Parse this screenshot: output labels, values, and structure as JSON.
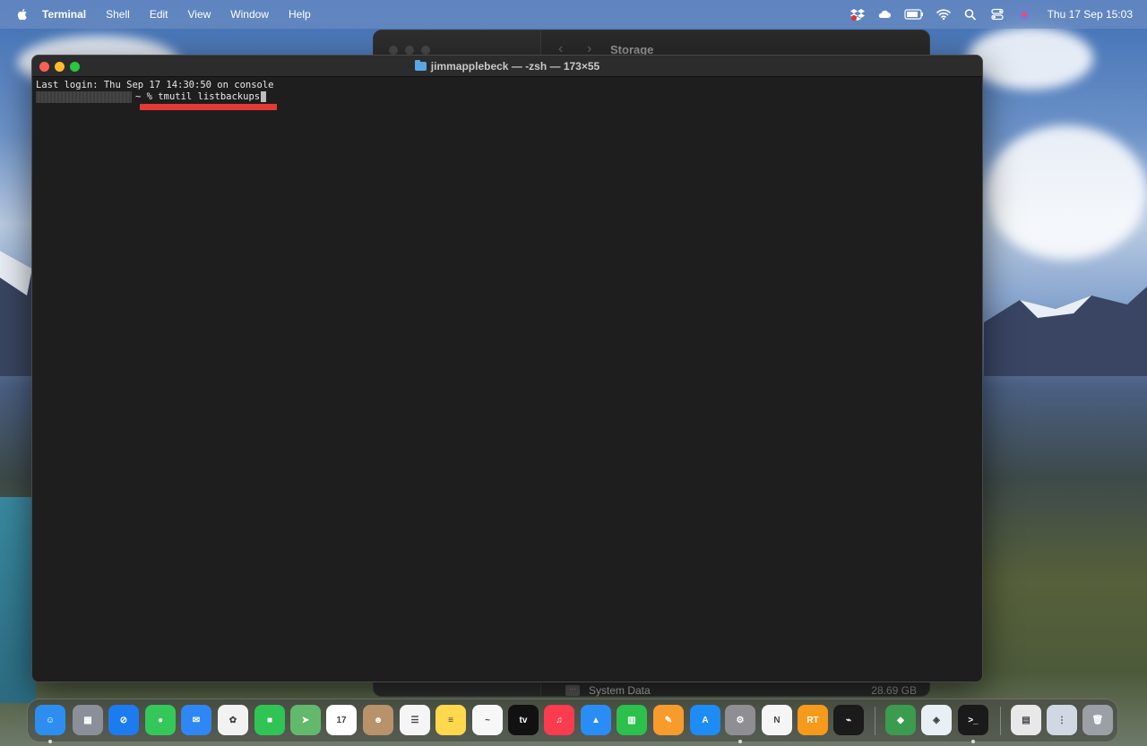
{
  "menubar": {
    "app_name": "Terminal",
    "items": [
      "Shell",
      "Edit",
      "View",
      "Window",
      "Help"
    ],
    "clock": "Thu 17 Sep  15:03"
  },
  "storage_window": {
    "title": "Storage",
    "row_label": "System Data",
    "row_size": "28.69 GB"
  },
  "terminal": {
    "title": "jimmapplebeck — -zsh — 173×55",
    "last_login": "Last login: Thu Sep 17 14:30:50 on console",
    "prompt": "~ % ",
    "command": "tmutil listbackups"
  },
  "dock": {
    "apps": [
      {
        "name": "finder-icon",
        "color": "#2d8ef0",
        "glyph": "☺"
      },
      {
        "name": "launchpad-icon",
        "color": "#8a8f9a",
        "glyph": "▦"
      },
      {
        "name": "safari-icon",
        "color": "#1d7bf0",
        "glyph": "⊘"
      },
      {
        "name": "messages-icon",
        "color": "#34c759",
        "glyph": "●"
      },
      {
        "name": "mail-icon",
        "color": "#2f87f5",
        "glyph": "✉"
      },
      {
        "name": "photos-icon",
        "color": "#f2f2f2",
        "glyph": "✿"
      },
      {
        "name": "facetime-icon",
        "color": "#30c454",
        "glyph": "■"
      },
      {
        "name": "maps-icon",
        "color": "#63b96b",
        "glyph": "➤"
      },
      {
        "name": "calendar-icon",
        "color": "#ffffff",
        "glyph": "17"
      },
      {
        "name": "contacts-icon",
        "color": "#b8926a",
        "glyph": "☻"
      },
      {
        "name": "reminders-icon",
        "color": "#f5f5f5",
        "glyph": "☰"
      },
      {
        "name": "notes-icon",
        "color": "#ffd84d",
        "glyph": "≡"
      },
      {
        "name": "freeform-icon",
        "color": "#f7f7f7",
        "glyph": "~"
      },
      {
        "name": "apple-tv-icon",
        "color": "#111111",
        "glyph": "tv"
      },
      {
        "name": "music-icon",
        "color": "#fa3c4e",
        "glyph": "♫"
      },
      {
        "name": "keynote-icon",
        "color": "#2a8df5",
        "glyph": "▲"
      },
      {
        "name": "numbers-icon",
        "color": "#2cc04c",
        "glyph": "▥"
      },
      {
        "name": "pages-icon",
        "color": "#f79b2d",
        "glyph": "✎"
      },
      {
        "name": "app-store-icon",
        "color": "#1d8cf5",
        "glyph": "A"
      },
      {
        "name": "system-settings-icon",
        "color": "#8e8e93",
        "glyph": "⚙"
      },
      {
        "name": "news-icon",
        "color": "#f5f5f5",
        "glyph": "N"
      },
      {
        "name": "rt-icon",
        "color": "#f59a1b",
        "glyph": "RT"
      },
      {
        "name": "activity-monitor-icon",
        "color": "#1b1b1b",
        "glyph": "⌁"
      },
      {
        "name": "app-icon-1",
        "color": "#3b9b4f",
        "glyph": "◆"
      },
      {
        "name": "app-icon-2",
        "color": "#e8f0f5",
        "glyph": "◈"
      },
      {
        "name": "terminal-icon",
        "color": "#1a1a1a",
        "glyph": ">_"
      },
      {
        "name": "preview-icon",
        "color": "#e8e8e8",
        "glyph": "▤"
      },
      {
        "name": "downloads-icon",
        "color": "#cfd8e3",
        "glyph": "⋮"
      },
      {
        "name": "trash-icon",
        "color": "#9aa0a6",
        "glyph": "🗑"
      }
    ]
  }
}
